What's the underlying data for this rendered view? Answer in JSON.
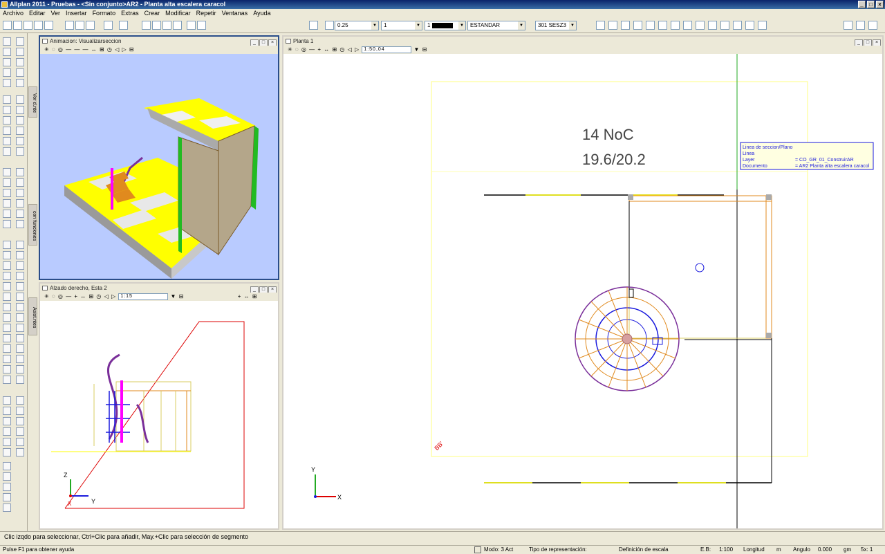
{
  "app": {
    "title": "Allplan 2011 - Pruebas - <Sin conjunto>AR2 - Planta alta escalera caracol"
  },
  "menu": [
    "Archivo",
    "Editar",
    "Ver",
    "Insertar",
    "Formato",
    "Extras",
    "Crear",
    "Modificar",
    "Repetir",
    "Ventanas",
    "Ayuda"
  ],
  "toolbar": {
    "pen": "0.25",
    "line": "1",
    "color": "1",
    "layer": "ESTANDAR",
    "layer2": "301 SESZ3"
  },
  "side_tabs": [
    "Vor d.nte",
    "con funciones",
    "Asist.ntes"
  ],
  "windows": {
    "anim": {
      "title": "Animacion: Visualizarseccion"
    },
    "alzado": {
      "title": "Alzado derecho, Esta 2",
      "combo": "1:15"
    },
    "planta": {
      "title": "Planta 1",
      "combo": "1:50,04"
    }
  },
  "drawing": {
    "label1": "14 NoC",
    "label2": "19.6/20.2",
    "corner_label": "BB'",
    "axis_x": "X",
    "axis_y": "Y",
    "axis_z": "Z",
    "tooltip": {
      "title": "Linea de seccion/Plano",
      "row1": "Linea",
      "row2a": "Layer",
      "row2b": "= CO_GR_01_ConstruirAR",
      "row3a": "Documento",
      "row3b": "= AR2 Planta alta escalera caracol"
    }
  },
  "status": {
    "prompt": "Clic izqdo para seleccionar, Ctrl+Clic para añadir, May.+Clic para selección de segmento",
    "help": "Pulse F1 para obtener ayuda",
    "mode": "Modo: 3 Act",
    "repr": "Tipo de representación:",
    "scale_def": "Definición de escala",
    "scale_label": "E.B:",
    "scale": "1:100",
    "length_label": "Longitud",
    "length_unit": "m",
    "angle_label": "Angulo",
    "angle": "0.000",
    "unit2": "gm",
    "zoom": "5x: 1"
  },
  "colors": {
    "accent": "#0a246a",
    "view3d_bg": "#b9cbff",
    "yellow": "#ffff00",
    "orange": "#e08a1e",
    "purple": "#7a2f9a",
    "blue": "#1a1add",
    "green": "#22bb22",
    "magenta": "#ff00ff"
  }
}
